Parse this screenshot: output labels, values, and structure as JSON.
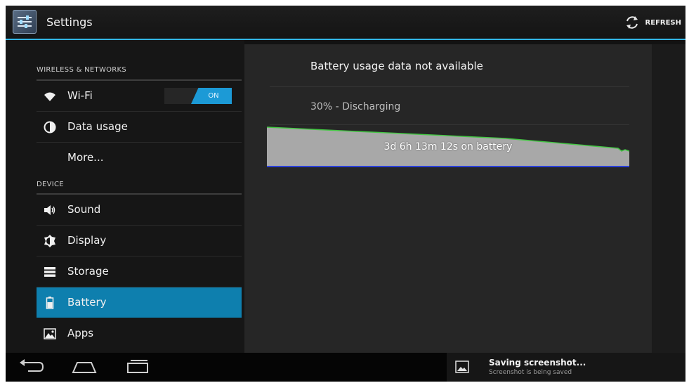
{
  "action_bar": {
    "title": "Settings",
    "refresh_label": "REFRESH",
    "app_icon": "settings-sliders-icon",
    "refresh_icon": "refresh-icon"
  },
  "sidebar": {
    "section_wireless": "WIRELESS & NETWORKS",
    "section_device": "DEVICE",
    "items": [
      {
        "label": "Wi-Fi",
        "icon": "wifi-icon"
      },
      {
        "label": "Data usage",
        "icon": "data-usage-icon"
      },
      {
        "label": "More..."
      },
      {
        "label": "Sound",
        "icon": "speaker-icon"
      },
      {
        "label": "Display",
        "icon": "brightness-icon"
      },
      {
        "label": "Storage",
        "icon": "storage-icon"
      },
      {
        "label": "Battery",
        "icon": "battery-icon"
      },
      {
        "label": "Apps",
        "icon": "apps-icon"
      }
    ],
    "selected_item": "Battery",
    "wifi_toggle_label": "ON"
  },
  "battery_panel": {
    "unavailable_text": "Battery usage data not available",
    "status_text": "30% - Discharging",
    "graph_label": "3d 6h 13m 12s on battery"
  },
  "notification": {
    "title": "Saving screenshot...",
    "subtitle": "Screenshot is being saved",
    "icon": "image-icon"
  },
  "navigation": {
    "back_icon": "back-icon",
    "home_icon": "home-icon",
    "recents_icon": "recent-apps-icon"
  },
  "colors": {
    "accent": "#33b5e5",
    "selected": "#0e7fae",
    "graph_line": "#45c745"
  }
}
